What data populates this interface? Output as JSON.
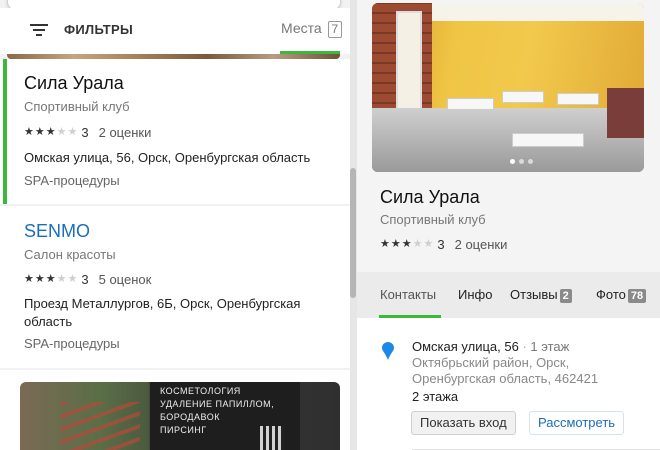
{
  "filters": {
    "label": "ФИЛЬТРЫ",
    "places_tab": "Места",
    "places_count": "7"
  },
  "results": [
    {
      "title": "Сила Урала",
      "category": "Спортивный клуб",
      "score": "3",
      "stars": 3,
      "reviews": "2 оценки",
      "address": "Омская улица, 56, Орск, Оренбургская область",
      "extra": "SPA-процедуры"
    },
    {
      "title": "SENMO",
      "category": "Салон красоты",
      "score": "3",
      "stars": 3,
      "reviews": "5 оценок",
      "address": "Проезд Металлургов, 6Б, Орск, Оренбургская область",
      "extra": "SPA-процедуры"
    }
  ],
  "card3_sign": [
    "КОСМЕТОЛОГИЯ",
    "УДАЛЕНИЕ ПАПИЛЛОМ,",
    "БОРОДАВОК",
    "ПИРСИНГ"
  ],
  "place": {
    "title": "Сила Урала",
    "category": "Спортивный клуб",
    "score": "3",
    "stars": 3,
    "reviews": "2 оценки",
    "tabs": [
      {
        "label": "Контакты"
      },
      {
        "label": "Инфо"
      },
      {
        "label": "Отзывы",
        "badge": "2"
      },
      {
        "label": "Фото",
        "badge": "78"
      }
    ],
    "address_street": "Омская улица, 56",
    "address_floor": "1 этаж",
    "address_region": "Октябрьский район, Орск, Оренбургская область, 462421",
    "floors": "2 этажа",
    "button_entrance": "Показать вход",
    "button_view": "Рассмотреть"
  },
  "colors": {
    "accent_green": "#3db83d",
    "link_blue": "#1a6dbb",
    "pin_blue": "#1e88e5"
  }
}
